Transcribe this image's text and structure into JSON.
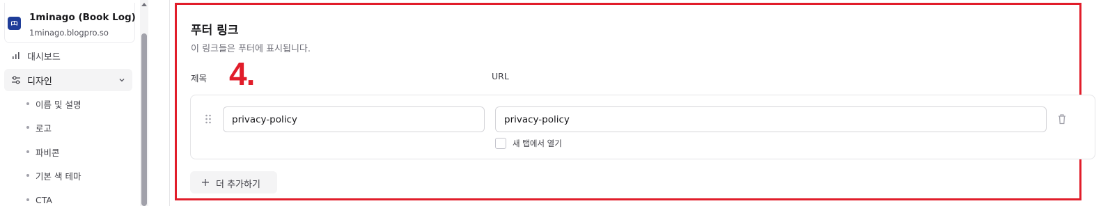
{
  "sidebar": {
    "site": {
      "title": "1minago (Book Log)",
      "url": "1minago.blogpro.so",
      "logo_icon": "book-logo-icon"
    },
    "nav": [
      {
        "label": "대시보드",
        "icon": "bar-chart-icon",
        "active": false
      },
      {
        "label": "디자인",
        "icon": "sliders-icon",
        "active": true,
        "expanded": true
      }
    ],
    "sub_items": [
      {
        "label": "이름 및 설명"
      },
      {
        "label": "로고"
      },
      {
        "label": "파비콘"
      },
      {
        "label": "기본 색 테마"
      },
      {
        "label": "CTA"
      }
    ]
  },
  "footer_links": {
    "title": "푸터 링크",
    "description": "이 링크들은 푸터에 표시됩니다.",
    "column_title": "제목",
    "column_url": "URL",
    "rows": [
      {
        "title": "privacy-policy",
        "url": "privacy-policy",
        "new_tab_label": "새 탭에서 열기",
        "new_tab": false
      }
    ],
    "add_button": "더 추가하기"
  },
  "annotation": {
    "label": "4.",
    "color": "#e11d2a"
  },
  "colors": {
    "highlight_border": "#e11d2a",
    "site_logo": "#1f3d99",
    "active_nav_bg": "#f4f4f5"
  }
}
